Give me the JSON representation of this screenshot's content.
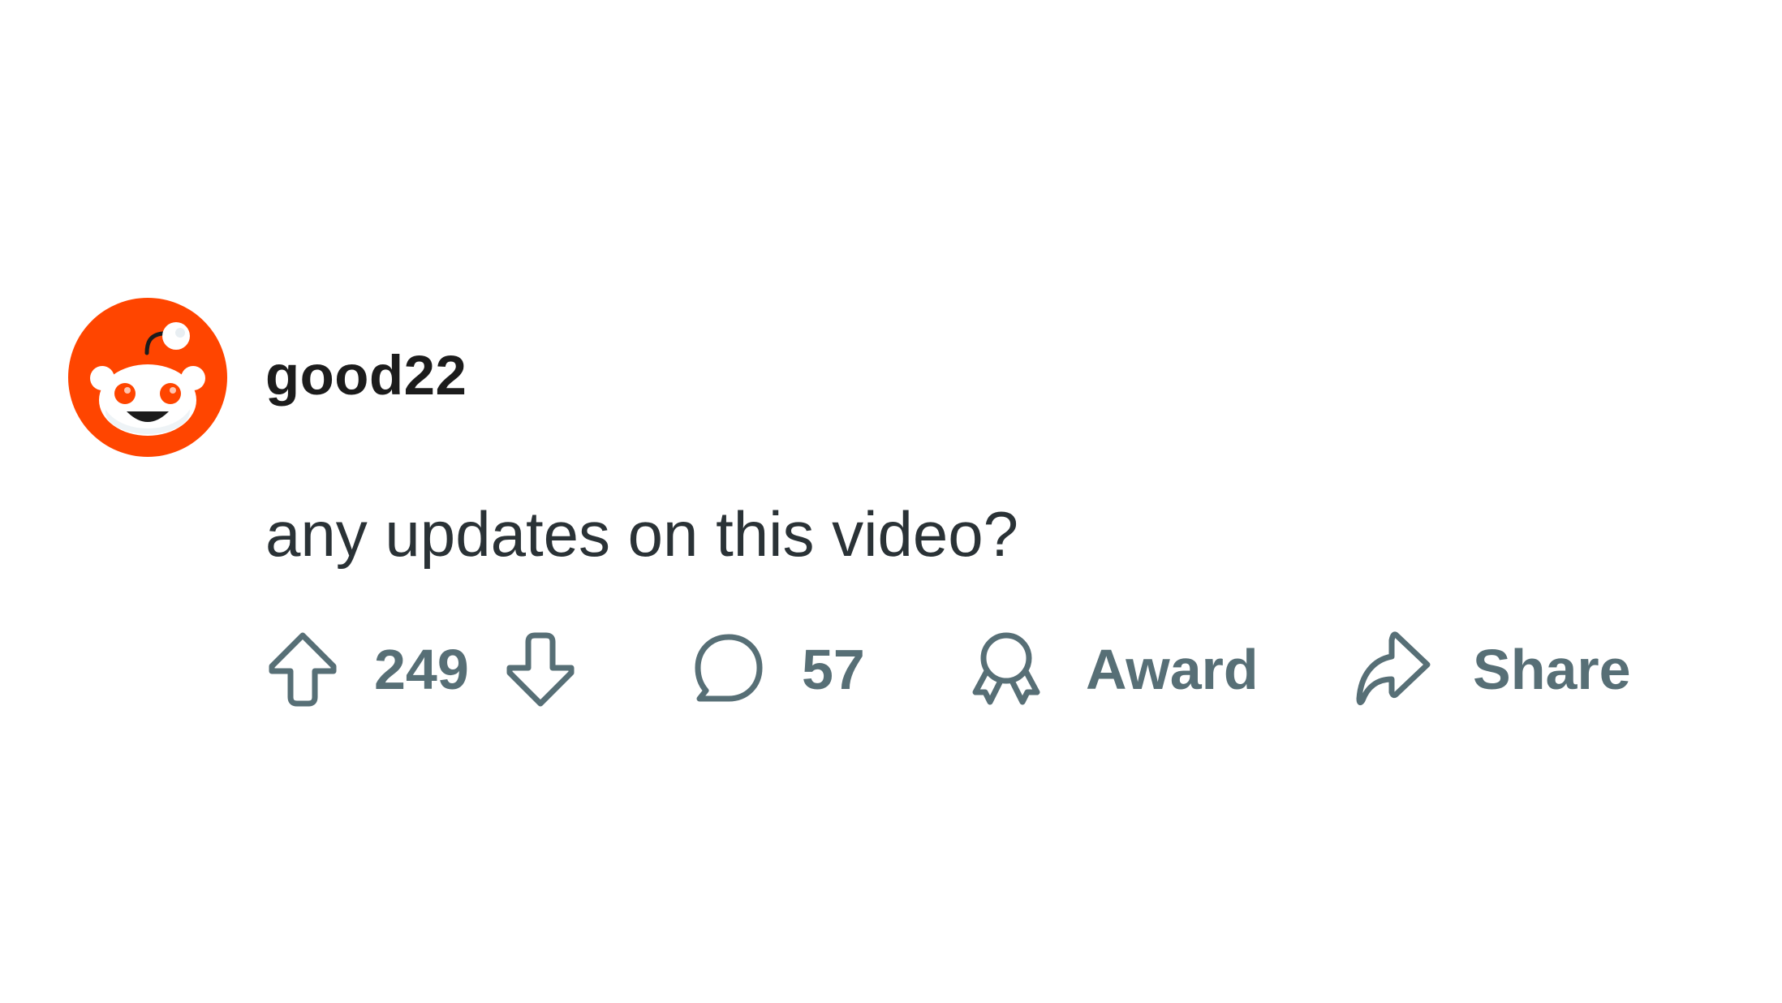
{
  "comment": {
    "author": "good22",
    "text": "any updates on this video?",
    "avatar_icon": "reddit-snoo-avatar-icon",
    "upvote_icon": "upvote-arrow-icon",
    "downvote_icon": "downvote-arrow-icon",
    "score": "249",
    "comments_icon": "speech-bubble-icon",
    "comments_count": "57",
    "award_icon": "award-ribbon-icon",
    "award_label": "Award",
    "share_icon": "share-arrow-icon",
    "share_label": "Share"
  },
  "colors": {
    "brand": "#ff4500",
    "action_gray": "#576f76",
    "username": "#1c1c1c",
    "body_text": "#2a3236",
    "background": "#ffffff"
  }
}
